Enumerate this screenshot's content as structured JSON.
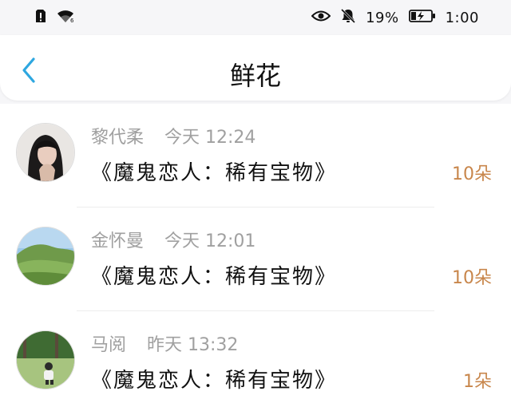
{
  "status_bar": {
    "left_icons": [
      "sim-alert-icon",
      "wifi-icon"
    ],
    "right_icons": [
      "eye-icon",
      "bell-muted-icon",
      "battery-charging-icon"
    ],
    "battery_percent": "19%",
    "time": "1:00"
  },
  "header": {
    "title": "鲜花",
    "back_icon": "chevron-left-icon",
    "accent_color": "#2ea7e0"
  },
  "gifts": [
    {
      "sender": "黎代柔",
      "time": "今天 12:24",
      "title": "《魔鬼恋人：稀有宝物》",
      "count": "10朵"
    },
    {
      "sender": "金怀曼",
      "time": "今天 12:01",
      "title": "《魔鬼恋人：稀有宝物》",
      "count": "10朵"
    },
    {
      "sender": "马阅",
      "time": "昨天 13:32",
      "title": "《魔鬼恋人：稀有宝物》",
      "count": "1朵"
    }
  ],
  "colors": {
    "count": "#c8864b",
    "meta": "#a0a0a0",
    "background": "#f6f6f8"
  }
}
